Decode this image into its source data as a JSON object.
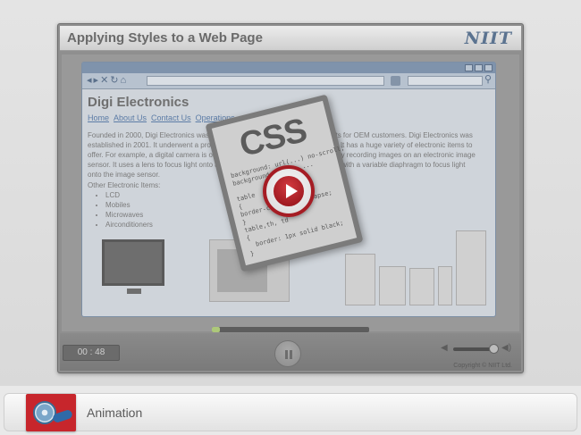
{
  "player": {
    "title": "Applying Styles to a Web Page",
    "brand": "NIIT",
    "time": "00 : 48",
    "copyright": "Copyright © NIIT Ltd.",
    "progress": 0.05
  },
  "browser": {
    "site_name": "Digi Electronics",
    "nav": [
      "Home",
      "About Us",
      "Contact Us",
      "Operations"
    ],
    "intro": "Founded in 2000, Digi Electronics was primarily a supplier of electronic products for OEM customers. Digi Electronics was established in 2001. It underwent a process of restructuring and reorganization. It has a huge variety of electronic items to offer. For example, a digital camera is one that takes video or still photographs by recording images on an electronic image sensor. It uses a lens to focus light onto an optical system, typically using a lens with a variable diaphragm to focus light onto the image sensor.",
    "other_title": "Other Electronic Items:",
    "items": [
      "LCD",
      "Mobiles",
      "Microwaves",
      "Airconditioners"
    ]
  },
  "css_card": {
    "heading": "CSS",
    "code": "background: url(...) no-scroll;\nbackground-repeat: ...\n\ntable\n{\nborder-collapse:collapse;\n}\ntable,th, td\n{\n  border: 1px solid black;\n}"
  },
  "bottom": {
    "label": "Animation"
  },
  "icons": {
    "back": "back-arrow-icon",
    "forward": "forward-arrow-icon",
    "stop": "stop-icon",
    "refresh": "refresh-icon",
    "home": "home-icon",
    "rss": "rss-icon",
    "search": "search-icon",
    "play": "play-icon",
    "pause": "pause-icon",
    "volume": "volume-icon",
    "animation": "film-reel-icon"
  },
  "colors": {
    "brand": "#5b7390",
    "play_red": "#a51d24",
    "progress_green": "#adc87a",
    "anim_red": "#c7262c"
  }
}
